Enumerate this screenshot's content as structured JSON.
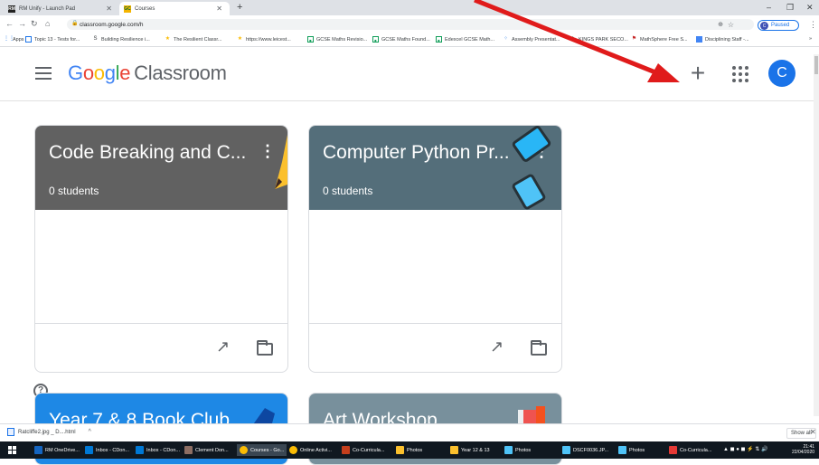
{
  "browser": {
    "tabs": [
      {
        "title": "RM Unify - Launch Pad",
        "favicon": "RM"
      },
      {
        "title": "Courses",
        "favicon": "GC"
      }
    ],
    "new_tab": "+",
    "window_controls": [
      "–",
      "❐",
      "✕"
    ],
    "url": "classroom.google.com/h",
    "profile_status": "Paused",
    "profile_initial": "C",
    "bookmarks": [
      {
        "label": "Apps",
        "icon": "apps-grid-icon"
      },
      {
        "label": "Topic 13 - Tests for...",
        "icon": "doc-icon"
      },
      {
        "label": "Building Resilience i...",
        "icon": "s-icon"
      },
      {
        "label": "The Resilient Classr...",
        "icon": "star-icon"
      },
      {
        "label": "https://www.leicest...",
        "icon": "star-icon"
      },
      {
        "label": "GCSE Maths Revisio...",
        "icon": "green-box-icon"
      },
      {
        "label": "GCSE Maths Found...",
        "icon": "green-box-icon"
      },
      {
        "label": "Edexcel GCSE Math...",
        "icon": "green-box-icon"
      },
      {
        "label": "Assembly Presentat...",
        "icon": "dots-icon"
      },
      {
        "label": "KINGS PARK SECO...",
        "icon": "crest-icon"
      },
      {
        "label": "MathSphere Free S...",
        "icon": "flag-icon"
      },
      {
        "label": "Disciplining Staff -...",
        "icon": "blue-square-icon"
      }
    ]
  },
  "header": {
    "brand_google": [
      "G",
      "o",
      "o",
      "g",
      "l",
      "e"
    ],
    "brand_product": "Classroom",
    "plus_label": "+",
    "avatar_initial": "C"
  },
  "courses": [
    {
      "title": "Code Breaking and C...",
      "students": "0 students",
      "color": "#616161"
    },
    {
      "title": "Computer Python Pr...",
      "students": "0 students",
      "color": "#546e7a"
    },
    {
      "title": "Year 7 & 8 Book Club",
      "students": "",
      "color": "#1e88e5"
    },
    {
      "title": "Art Workshop",
      "students": "",
      "color": "#78909c"
    }
  ],
  "download_bar": {
    "file": "Ratcliffe2.jpg _ D....html",
    "show_all": "Show all"
  },
  "taskbar": {
    "items": [
      "RM OneDrive...",
      "Inbox - CDon...",
      "Inbox - CDon...",
      "Clement Don...",
      "Courses - Go...",
      "Online Activi...",
      "Co-Curricula...",
      "Photos",
      "Year 12 & 13",
      "Photos",
      "DSCF0036.JP...",
      "Photos",
      "Co-Curricula..."
    ],
    "time": "21:41",
    "date": "22/04/2020"
  },
  "annotation_color": "#e01b1b"
}
